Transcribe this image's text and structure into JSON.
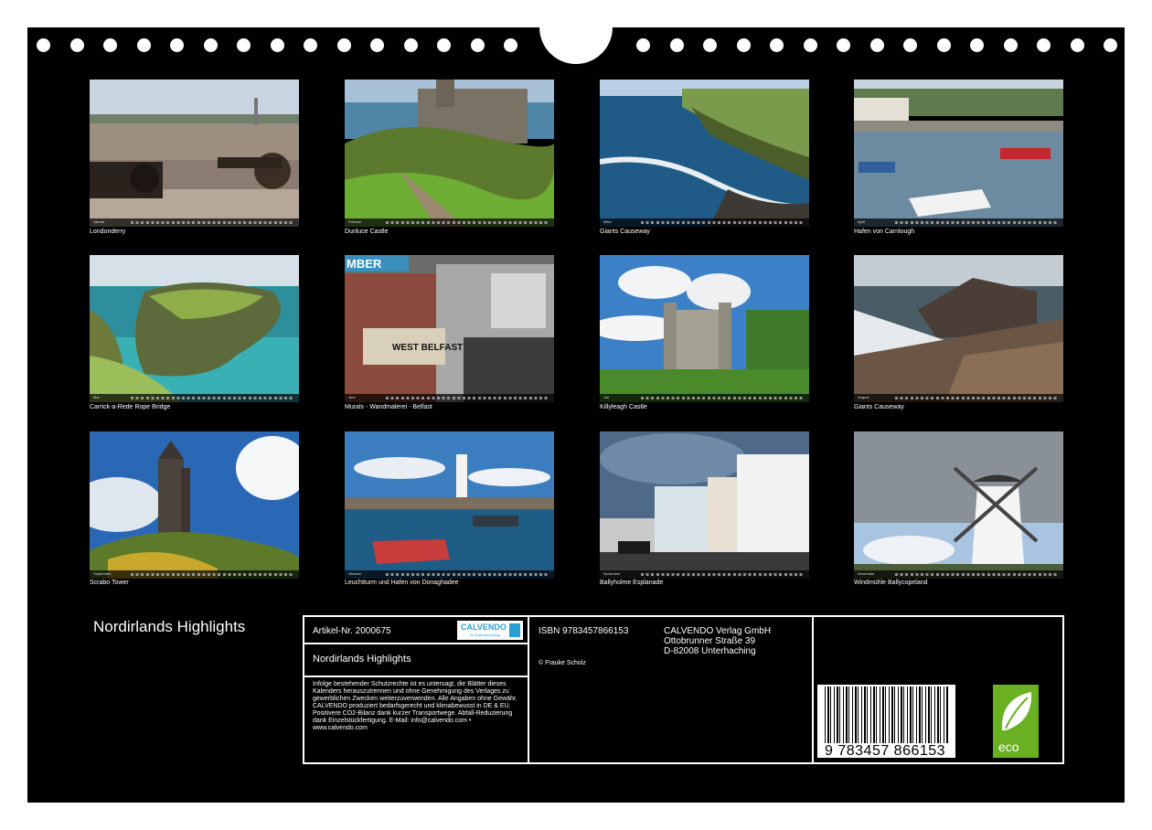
{
  "months": [
    {
      "month": "Januar",
      "caption": "Londonderry"
    },
    {
      "month": "Februar",
      "caption": "Dunluce Castle"
    },
    {
      "month": "März",
      "caption": "Giants Causeway"
    },
    {
      "month": "April",
      "caption": "Hafen von Carnlough"
    },
    {
      "month": "Mai",
      "caption": "Carrick-a-Rede Rope Bridge"
    },
    {
      "month": "Juni",
      "caption": "Murals - Wandmalerei - Belfast"
    },
    {
      "month": "Juli",
      "caption": "Killyleagh Castle"
    },
    {
      "month": "August",
      "caption": "Giants Causeway"
    },
    {
      "month": "September",
      "caption": "Scrabo Tower"
    },
    {
      "month": "Oktober",
      "caption": "Leuchtturm und Hafen von Donaghadee"
    },
    {
      "month": "November",
      "caption": "Ballyholme Esplanade"
    },
    {
      "month": "Dezember",
      "caption": "Windmühle Ballycopeland"
    }
  ],
  "calendar_title": "Nordirlands Highlights",
  "info": {
    "article": "Artikel-Nr. 2000675",
    "logo_text": "CALVENDO",
    "logo_sub": "Ihr Kalenderverlag",
    "title": "Nordirlands Highlights",
    "legal": "Infolge bestehender Schutzrechte ist es untersagt, die Blätter dieses Kalenders herauszutrennen und ohne Genehmigung des Verlages zu gewerblichen Zwecken weiterzuverwenden. Alle Angaben ohne Gewähr. CALVENDO produziert bedarfsgerecht und klimabewusst in DE & EU. Positivere CO2-Bilanz dank kurzer Transportwege. Abfall-Reduzierung dank Einzelstückfertigung. E-Mail: info@calvendo.com • www.calvendo.com",
    "isbn": "ISBN 9783457866153",
    "copyright": "© Frauke Scholz",
    "publisher": "CALVENDO Verlag GmbH",
    "street": "Ottobrunner Straße 39",
    "city": "D-82008 Unterhaching",
    "barcode_number": "9 783457 866153",
    "eco_label": "eco"
  }
}
